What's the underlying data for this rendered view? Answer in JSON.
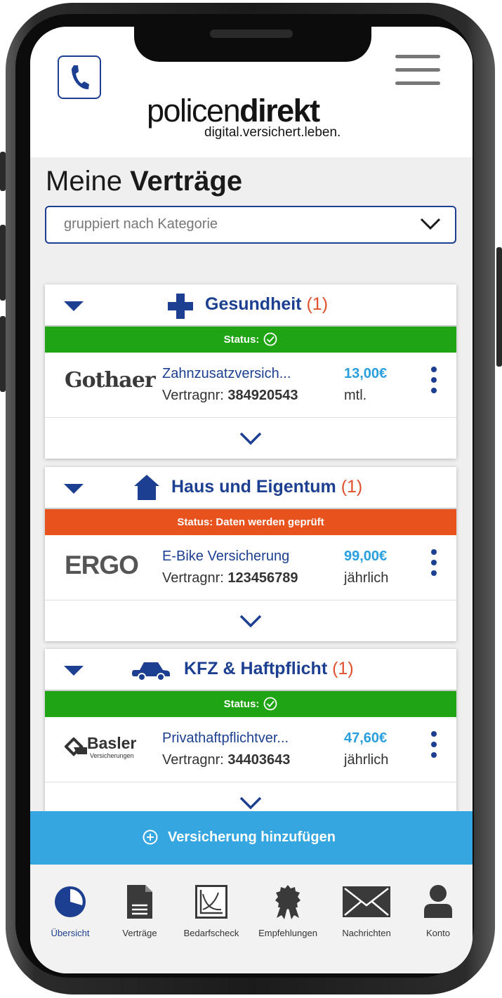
{
  "header": {
    "logo_word_light": "policen",
    "logo_word_bold": "direkt",
    "logo_tagline": "digital.versichert.leben."
  },
  "page": {
    "title_light": "Meine",
    "title_bold": "Verträge"
  },
  "grouping_select": {
    "value": "gruppiert nach Kategorie"
  },
  "categories": [
    {
      "name": "Gesundheit",
      "count": "(1)",
      "icon": "medical-cross-icon",
      "status_text": "Status:",
      "status_color": "#1fa413",
      "contract": {
        "insurer": "Gothaer",
        "product": "Zahnzusatzversich...",
        "number_label": "Vertragnr:",
        "number": "384920543",
        "price": "13,00€",
        "period": "mtl."
      }
    },
    {
      "name": "Haus und Eigentum",
      "count": "(1)",
      "icon": "house-icon",
      "status_text": "Status: Daten werden geprüft",
      "status_color": "#e8531d",
      "contract": {
        "insurer": "ERGO",
        "product": "E-Bike Versicherung",
        "number_label": "Vertragnr:",
        "number": "123456789",
        "price": "99,00€",
        "period": "jährlich"
      }
    },
    {
      "name": "KFZ & Haftpflicht",
      "count": "(1)",
      "icon": "car-icon",
      "status_text": "Status:",
      "status_color": "#1fa413",
      "contract": {
        "insurer": "Basler",
        "insurer_sub": "Versicherungen",
        "product": "Privathaftpflichtver...",
        "number_label": "Vertragnr:",
        "number": "34403643",
        "price": "47,60€",
        "period": "jährlich"
      }
    }
  ],
  "add_button": {
    "label": "Versicherung hinzufügen"
  },
  "tabbar": {
    "items": [
      {
        "label": "Übersicht",
        "icon": "pie-chart-icon",
        "active": true
      },
      {
        "label": "Verträge",
        "icon": "document-icon",
        "active": false
      },
      {
        "label": "Bedarfscheck",
        "icon": "graph-icon",
        "active": false
      },
      {
        "label": "Empfehlungen",
        "icon": "award-icon",
        "active": false
      },
      {
        "label": "Nachrichten",
        "icon": "envelope-icon",
        "active": false
      },
      {
        "label": "Konto",
        "icon": "user-icon",
        "active": false
      }
    ]
  },
  "colors": {
    "brand_blue": "#1d3f91",
    "price_blue": "#2a9fdd",
    "add_button": "#35a6e0",
    "count_orange": "#e0512d"
  }
}
